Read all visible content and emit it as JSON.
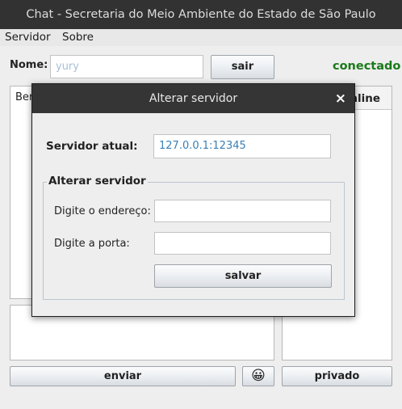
{
  "window": {
    "title": "Chat - Secretaria do Meio Ambiente do Estado de São Paulo"
  },
  "menubar": {
    "items": [
      "Servidor",
      "Sobre"
    ]
  },
  "top": {
    "name_label": "Nome:",
    "name_value": "yury",
    "exit_button": "sair",
    "status": "conectado",
    "status_color": "#1a7a1a"
  },
  "chat": {
    "messages_partial": "Ber",
    "online_header_partial": "nline"
  },
  "bottom": {
    "send_button": "enviar",
    "emoji": "😀",
    "private_button": "privado"
  },
  "dialog": {
    "title": "Alterar servidor",
    "close_glyph": "×",
    "current_server_label": "Servidor atual:",
    "current_server_value": "127.0.0.1:12345",
    "group_title": "Alterar servidor",
    "address_label": "Digite o endereço:",
    "address_value": "",
    "port_label": "Digite a porta:",
    "port_value": "",
    "save_button": "salvar"
  }
}
